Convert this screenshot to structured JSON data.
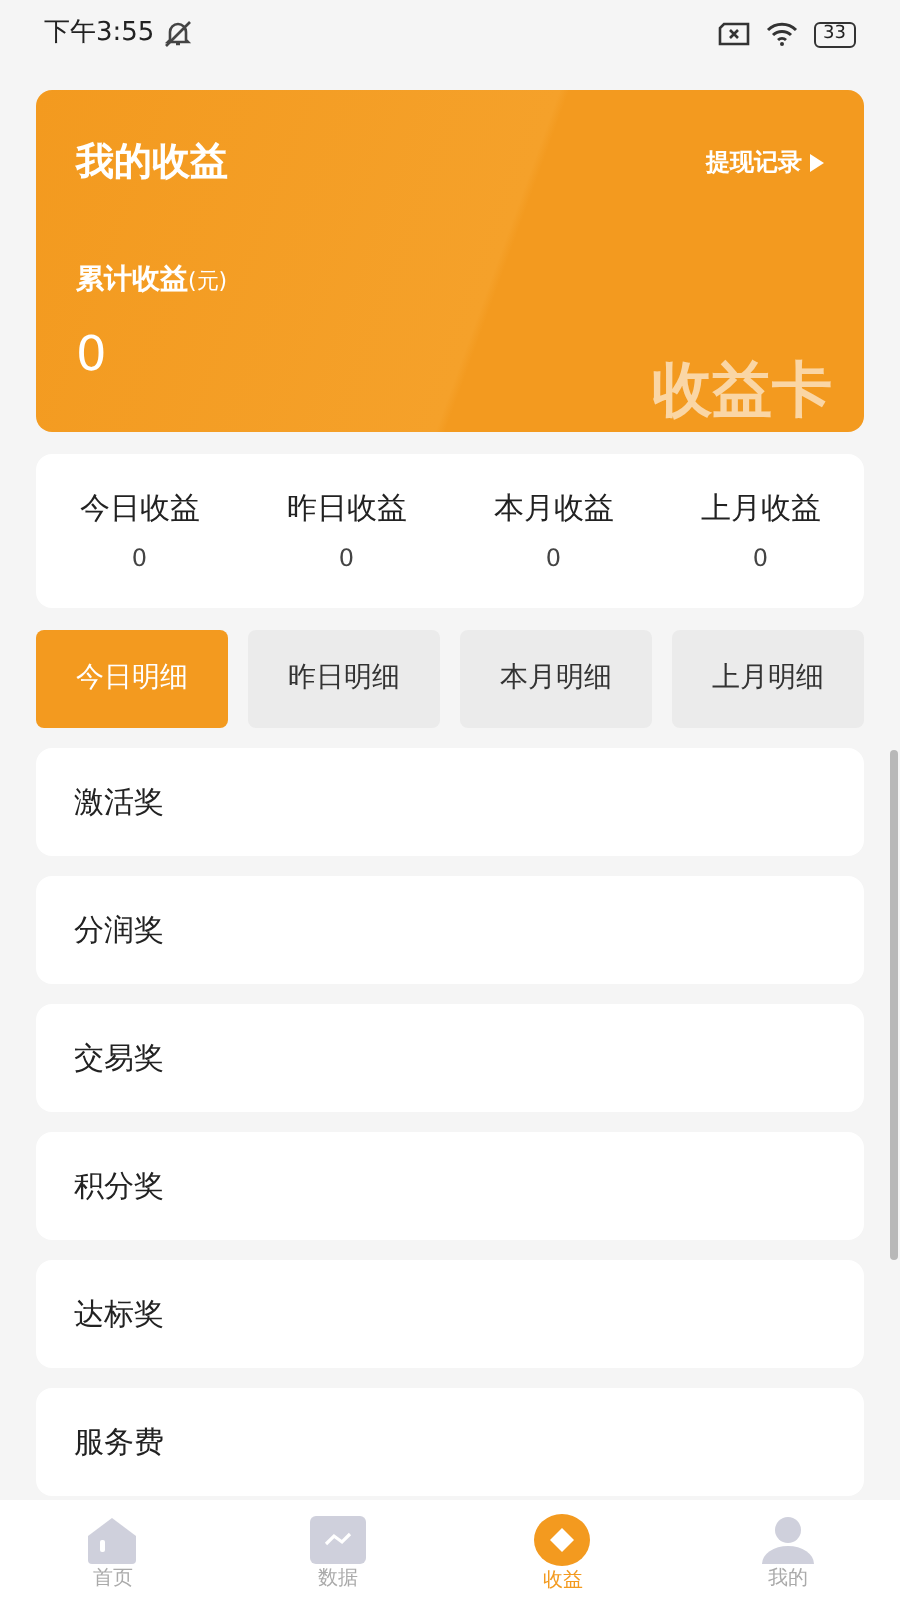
{
  "status_bar": {
    "time": "下午3:55",
    "battery": "33"
  },
  "earnings_card": {
    "title": "我的收益",
    "link": "提现记录",
    "total_label": "累计收益",
    "total_unit": "(元)",
    "total_value": "0",
    "watermark": "收益卡"
  },
  "stats": [
    {
      "label": "今日收益",
      "value": "0"
    },
    {
      "label": "昨日收益",
      "value": "0"
    },
    {
      "label": "本月收益",
      "value": "0"
    },
    {
      "label": "上月收益",
      "value": "0"
    }
  ],
  "detail_tabs": [
    {
      "label": "今日明细",
      "selected": true
    },
    {
      "label": "昨日明细",
      "selected": false
    },
    {
      "label": "本月明细",
      "selected": false
    },
    {
      "label": "上月明细",
      "selected": false
    }
  ],
  "rewards": [
    {
      "label": "激活奖"
    },
    {
      "label": "分润奖"
    },
    {
      "label": "交易奖"
    },
    {
      "label": "积分奖"
    },
    {
      "label": "达标奖"
    },
    {
      "label": "服务费"
    }
  ],
  "tab_bar": [
    {
      "label": "首页",
      "kind": "home",
      "selected": false
    },
    {
      "label": "数据",
      "kind": "chart",
      "selected": false
    },
    {
      "label": "收益",
      "kind": "coin",
      "selected": true
    },
    {
      "label": "我的",
      "kind": "user",
      "selected": false
    }
  ]
}
